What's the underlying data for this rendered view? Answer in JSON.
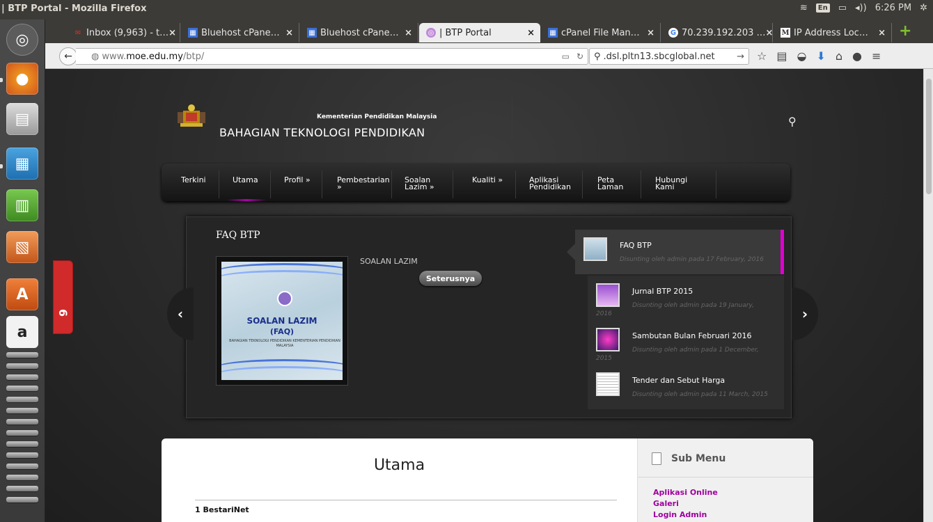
{
  "window": {
    "title": "| BTP Portal - Mozilla Firefox",
    "keyboard": "En",
    "clock": "6:26 PM"
  },
  "tabs": [
    {
      "label": "Inbox (9,963) - t…",
      "icon": "gmail-icon"
    },
    {
      "label": "Bluehost cPane…",
      "icon": "cpanel-icon"
    },
    {
      "label": "Bluehost cPane…",
      "icon": "cpanel-icon"
    },
    {
      "label": "| BTP Portal",
      "icon": "btp-icon"
    },
    {
      "label": "cPanel File Man…",
      "icon": "cpanel-icon"
    },
    {
      "label": "70.239.192.203 …",
      "icon": "google-icon"
    },
    {
      "label": "IP Address Loc…",
      "icon": "m-icon"
    }
  ],
  "nav": {
    "url_scheme": "www.",
    "url_host": "moe.edu.my",
    "url_path": "/btp/",
    "search_value": ".dsl.pltn13.sbcglobal.net"
  },
  "site": {
    "ministry": "Kementerian Pendidikan Malaysia",
    "division": "BAHAGIAN TEKNOLOGI PENDIDIKAN",
    "menu": [
      {
        "l1": "Terkini",
        "l2": ""
      },
      {
        "l1": "Utama",
        "l2": ""
      },
      {
        "l1": "Profil »",
        "l2": ""
      },
      {
        "l1": "Pembestarian",
        "l2": "»"
      },
      {
        "l1": "Soalan",
        "l2": "Lazim »"
      },
      {
        "l1": "Kualiti »",
        "l2": ""
      },
      {
        "l1": "Aplikasi",
        "l2": "Pendidikan"
      },
      {
        "l1": "Peta",
        "l2": "Laman"
      },
      {
        "l1": "Hubungi",
        "l2": "Kami"
      }
    ]
  },
  "slider": {
    "title": "FAQ BTP",
    "caption": "SOALAN LAZIM",
    "more": "Seterusnya",
    "card": {
      "t1": "SOALAN LAZIM",
      "t2": "(FAQ)",
      "t3": "BAHAGIAN TEKNOLOGI PENDIDIKAN\nKEMENTERIAN PENDIDIKAN MALAYSIA"
    },
    "items": [
      {
        "title": "FAQ BTP",
        "meta": "Disunting oleh admin pada 17 February, 2016",
        "year": ""
      },
      {
        "title": "Jurnal BTP 2015",
        "meta": "Disunting oleh admin pada 19 January,",
        "year": "2016"
      },
      {
        "title": "Sambutan Bulan Februari 2016",
        "meta": "Disunting oleh admin pada 1 December,",
        "year": "2015"
      },
      {
        "title": "Tender dan Sebut Harga",
        "meta": "Disunting oleh admin pada 11 March, 2015",
        "year": ""
      }
    ]
  },
  "content": {
    "heading": "Utama",
    "first_item": "1 BestariNet",
    "sidebar_title": "Sub Menu",
    "sidebar_links": [
      "Aplikasi Online",
      "Galeri",
      "Login Admin"
    ]
  },
  "feedback": {
    "label": "6"
  },
  "colors": {
    "accent": "#e000d0",
    "link": "#a000a0"
  }
}
